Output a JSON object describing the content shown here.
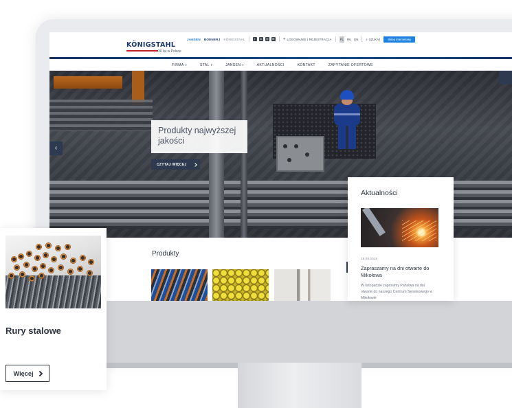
{
  "header": {
    "logo_text": "KÖNIGSTAHL",
    "logo_tagline": "30 lat w Polsce",
    "brands": [
      "JANSEN",
      "BOENERJ",
      "KÖNIGSTAHL"
    ],
    "social_icons": [
      "facebook-icon",
      "linkedin-icon",
      "instagram-icon",
      "mail-icon"
    ],
    "login_label": "LOGOWANIE | REJESTRACJA",
    "languages": [
      "PL",
      "RU",
      "EN"
    ],
    "active_language": "PL",
    "search_label": "SZUKAJ",
    "shop_button": "Sklep internetowy"
  },
  "nav": {
    "items": [
      {
        "label": "FIRMA",
        "dropdown": true
      },
      {
        "label": "STAL",
        "dropdown": true
      },
      {
        "label": "JANSEN",
        "dropdown": true
      },
      {
        "label": "AKTUALNOŚCI",
        "dropdown": false
      },
      {
        "label": "KONTAKT",
        "dropdown": false
      },
      {
        "label": "ZAPYTANIE OFERTOWE",
        "dropdown": false
      }
    ]
  },
  "hero": {
    "title": "Produkty najwyższej jakości",
    "button": "CZYTAJ WIĘCEJ",
    "prev_icon": "‹"
  },
  "products": {
    "title": "Produkty"
  },
  "news": {
    "heading": "Aktualności",
    "date": "19.09.2019",
    "title": "Zapraszamy na dni otwarte do Mikołowa",
    "excerpt": "W listopadzie zaprosimy Państwa na dni otwarte do naszego Centrum Serwisowego w Mikołowie"
  },
  "product_card": {
    "title": "Rury stalowe",
    "button": "Więcej"
  },
  "colors": {
    "navy": "#2e3a4f",
    "brand_blue": "#1a3a6e",
    "shop_blue": "#1e82e0",
    "logo_red": "#c0202a"
  }
}
